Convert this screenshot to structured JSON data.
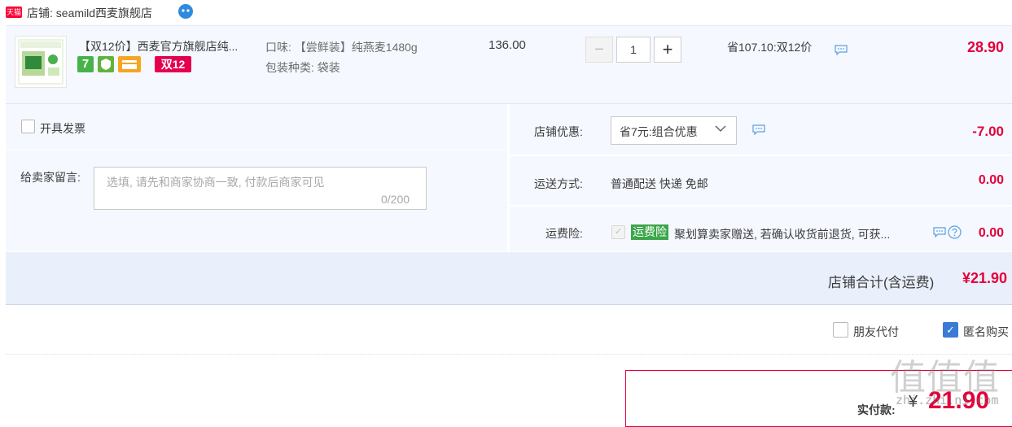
{
  "shop": {
    "badge": "天猫",
    "name": "店铺: seamild西麦旗舰店"
  },
  "item": {
    "title": "【双12价】西麦官方旗舰店纯...",
    "badge_seven": "7",
    "badge_double12": "双12",
    "sku_flavor": "口味: 【尝鲜装】纯燕麦1480g",
    "sku_pack": "包装种类: 袋装",
    "unit_price": "136.00",
    "qty_minus": "−",
    "quantity": "1",
    "qty_plus": "+",
    "save_note": "省107.10:双12价",
    "subtotal": "28.90"
  },
  "invoice": {
    "label": "开具发票"
  },
  "message": {
    "label": "给卖家留言:",
    "placeholder": "选填, 请先和商家协商一致, 付款后商家可见",
    "count": "0/200"
  },
  "promo": {
    "label": "店铺优惠:",
    "selected": "省7元:组合优惠",
    "amount": "-7.00"
  },
  "shipping": {
    "label": "运送方式:",
    "value": "普通配送 快递 免邮",
    "amount": "0.00"
  },
  "insurance": {
    "label": "运费险:",
    "badge": "运费险",
    "desc": "聚划算卖家赠送, 若确认收货前退货, 可获...",
    "amount": "0.00"
  },
  "total": {
    "label": "店铺合计(含运费)",
    "amount": "¥21.90"
  },
  "options": {
    "friend_pay": "朋友代付",
    "anonymous": "匿名购买",
    "anonymous_checked": true
  },
  "pay": {
    "label": "实付款:",
    "currency": "¥",
    "amount": "21.90"
  },
  "watermark": {
    "chars": "值值值",
    "site": "zhi.zhi.ni.com"
  },
  "colors": {
    "accent_red": "#e4003a",
    "bg_blue": "#f5f8ff",
    "check_blue": "#3a7bd5"
  }
}
